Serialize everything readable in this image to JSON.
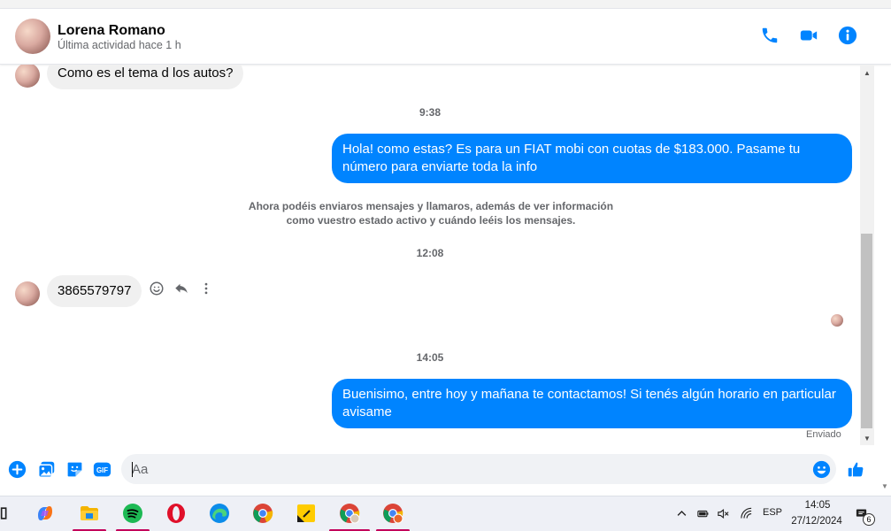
{
  "header": {
    "contact_name": "Lorena Romano",
    "status": "Última actividad hace 1 h",
    "accent_color": "#0084ff"
  },
  "conversation": {
    "earlier_message": "Como es el tema d los autos?",
    "time_1": "9:38",
    "outgoing_1": "Hola! como estas? Es para un FIAT mobi con cuotas de $183.000. Pasame tu número para enviarte toda la info",
    "system_notice": "Ahora podéis enviaros mensajes y llamaros, además de ver información como vuestro estado activo y cuándo leéis los mensajes.",
    "time_2": "12:08",
    "incoming_phone": "3865579797",
    "time_3": "14:05",
    "outgoing_2": "Buenisimo, entre hoy y mañana te contactamos! Si tenés algún horario en particular avisame",
    "sent_status": "Enviado"
  },
  "composer": {
    "placeholder": "Aa",
    "value": "",
    "gif_label": "GIF"
  },
  "taskbar": {
    "language": "ESP",
    "time": "14:05",
    "date": "27/12/2024",
    "notification_count": "6"
  }
}
